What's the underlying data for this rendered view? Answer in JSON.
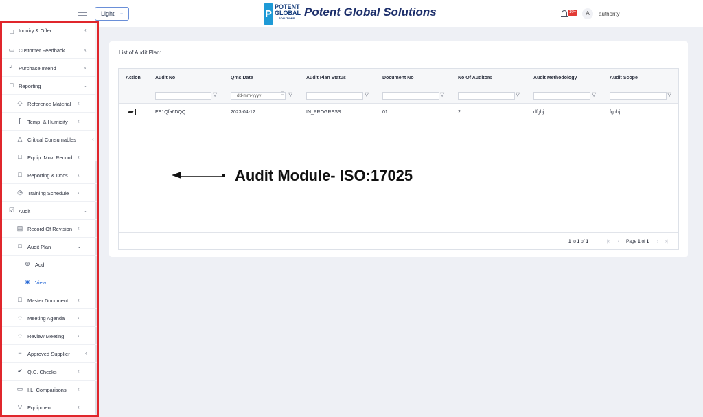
{
  "header": {
    "theme_label": "Light",
    "logo_line1": "POTENT",
    "logo_line2": "GLOBAL",
    "logo_line3": "SOLUTIONS",
    "brand_name": "Potent Global Solutions",
    "notification_count": "10+",
    "user_initial": "A",
    "user_name": "authority"
  },
  "sidebar": {
    "items": [
      {
        "label": "Inquiry & Offer",
        "icon": "document-icon"
      },
      {
        "label": "Customer Feedback",
        "icon": "message-icon"
      },
      {
        "label": "Purchase Intend",
        "icon": "cart-icon"
      },
      {
        "label": "Reporting",
        "icon": "document-icon"
      },
      {
        "label": "Reference Material",
        "icon": "box-icon"
      },
      {
        "label": "Temp. & Humidity",
        "icon": "thermometer-icon"
      },
      {
        "label": "Critical Consumables",
        "icon": "warning-icon"
      },
      {
        "label": "Equip. Mov. Record",
        "icon": "document-icon"
      },
      {
        "label": "Reporting & Docs",
        "icon": "document-icon"
      },
      {
        "label": "Training Schedule",
        "icon": "clock-icon"
      },
      {
        "label": "Audit",
        "icon": "checklist-icon"
      },
      {
        "label": "Record Of Revision",
        "icon": "printer-icon"
      },
      {
        "label": "Audit Plan",
        "icon": "document-icon"
      },
      {
        "label": "Add",
        "icon": "plus-circle-icon"
      },
      {
        "label": "View",
        "icon": "eye-icon"
      },
      {
        "label": "Master Document",
        "icon": "document-icon"
      },
      {
        "label": "Meeting Agenda",
        "icon": "sun-icon"
      },
      {
        "label": "Review Meeting",
        "icon": "sun-icon"
      },
      {
        "label": "Approved Supplier",
        "icon": "sliders-icon"
      },
      {
        "label": "Q.C. Checks",
        "icon": "check-circle-icon"
      },
      {
        "label": "I.L. Comparisons",
        "icon": "monitor-icon"
      },
      {
        "label": "Equipment",
        "icon": "filter-icon"
      }
    ]
  },
  "main": {
    "card_title": "List of Audit Plan:",
    "columns": [
      "Action",
      "Audit No",
      "Qms Date",
      "Audit Plan Status",
      "Document No",
      "No Of Auditors",
      "Audit Methodology",
      "Audit Scope"
    ],
    "date_placeholder": "dd-mm-yyyy",
    "rows": [
      {
        "audit_no": "EE1Qfa6DQQ",
        "qms_date": "2023-04-12",
        "status": "IN_PROGRESS",
        "document_no": "01",
        "no_of_auditors": "2",
        "methodology": "dfghj",
        "scope": "fghhj"
      }
    ],
    "pagination": {
      "range_from": "1",
      "range_to_word": "to",
      "range_to": "1",
      "range_of_word": "of",
      "range_total": "1",
      "page_word": "Page",
      "page_current": "1",
      "page_of_word": "of",
      "page_total": "1"
    }
  },
  "annotation": {
    "text": "Audit Module- ISO:17025"
  },
  "colors": {
    "accent": "#2c6cd6",
    "highlight_border": "#e0262c",
    "brand": "#1d2f6b"
  }
}
